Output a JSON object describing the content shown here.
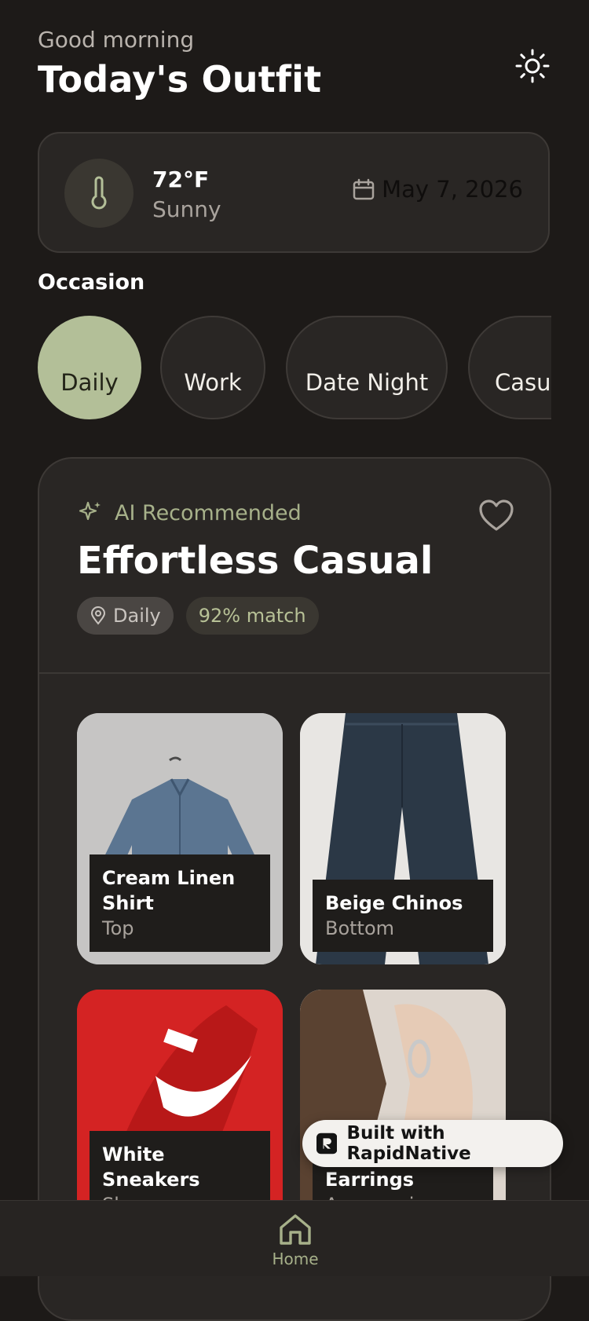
{
  "header": {
    "greeting": "Good morning",
    "title": "Today's Outfit",
    "theme_icon": "sun-icon"
  },
  "weather": {
    "temperature": "72°F",
    "condition": "Sunny",
    "date": "May 7, 2026",
    "icon": "thermometer-icon"
  },
  "occasion": {
    "label": "Occasion",
    "options": [
      "Daily",
      "Work",
      "Date Night",
      "Casual"
    ],
    "selected": "Daily"
  },
  "recommendation": {
    "badge": "AI Recommended",
    "title": "Effortless Casual",
    "occasion_tag": "Daily",
    "match": "92% match",
    "items": [
      {
        "name": "Cream Linen Shirt",
        "category": "Top"
      },
      {
        "name": "Beige Chinos",
        "category": "Bottom"
      },
      {
        "name": "White Sneakers",
        "category": "Shoes"
      },
      {
        "name": "Earrings",
        "category": "Accessories"
      }
    ]
  },
  "builder_badge": {
    "text": "Built with RapidNative"
  },
  "tabbar": {
    "home_label": "Home"
  },
  "colors": {
    "background": "#1d1a18",
    "accent": "#b3bf98",
    "card": "#292624"
  }
}
